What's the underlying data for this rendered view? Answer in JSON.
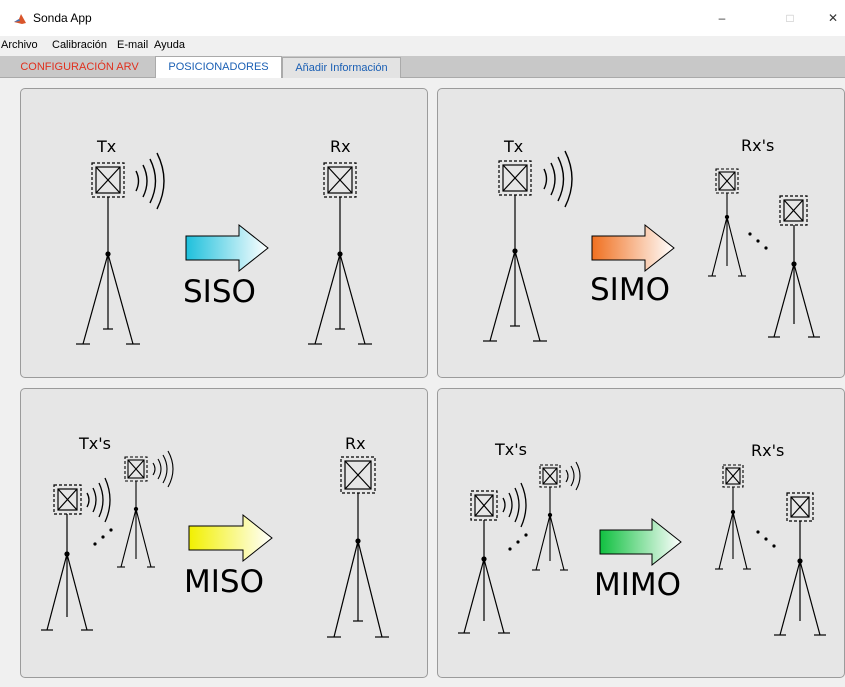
{
  "window": {
    "title": "Sonda App",
    "icon": "matlab-icon"
  },
  "window_controls": {
    "minimize": "–",
    "maximize": "□",
    "close": "✕"
  },
  "menu": [
    "Archivo",
    "Calibración",
    "E-mail",
    "Ayuda"
  ],
  "tabs": [
    {
      "label": "CONFIGURACIÓN ARV",
      "color": "#e0301e"
    },
    {
      "label": "POSICIONADORES",
      "color": "#1a5fb4",
      "selected": true
    },
    {
      "label": "Añadir Información",
      "color": "#1a5fb4"
    }
  ],
  "panels": [
    {
      "mode": "SISO",
      "tx_label": "Tx",
      "rx_label": "Rx",
      "arrow_color": "#1ec0dc"
    },
    {
      "mode": "SIMO",
      "tx_label": "Tx",
      "rx_label": "Rx's",
      "arrow_color": "#f07020"
    },
    {
      "mode": "MISO",
      "tx_label": "Tx's",
      "rx_label": "Rx",
      "arrow_color": "#f2f000"
    },
    {
      "mode": "MIMO",
      "tx_label": "Tx's",
      "rx_label": "Rx's",
      "arrow_color": "#10c040"
    }
  ]
}
